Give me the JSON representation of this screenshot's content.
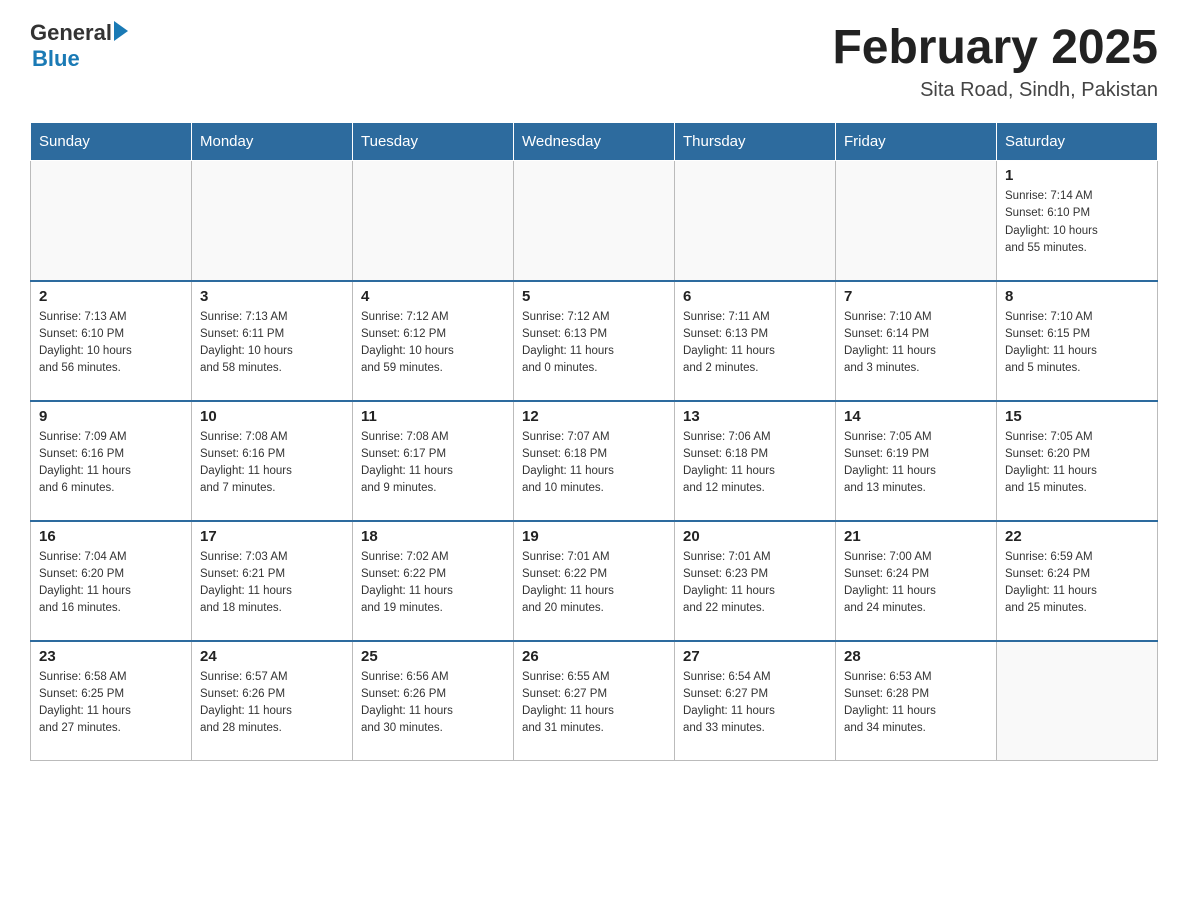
{
  "logo": {
    "text_general": "General",
    "text_blue": "Blue",
    "arrow": "▶"
  },
  "title": "February 2025",
  "subtitle": "Sita Road, Sindh, Pakistan",
  "days_of_week": [
    "Sunday",
    "Monday",
    "Tuesday",
    "Wednesday",
    "Thursday",
    "Friday",
    "Saturday"
  ],
  "weeks": [
    {
      "cells": [
        {
          "day": "",
          "info": ""
        },
        {
          "day": "",
          "info": ""
        },
        {
          "day": "",
          "info": ""
        },
        {
          "day": "",
          "info": ""
        },
        {
          "day": "",
          "info": ""
        },
        {
          "day": "",
          "info": ""
        },
        {
          "day": "1",
          "info": "Sunrise: 7:14 AM\nSunset: 6:10 PM\nDaylight: 10 hours\nand 55 minutes."
        }
      ]
    },
    {
      "cells": [
        {
          "day": "2",
          "info": "Sunrise: 7:13 AM\nSunset: 6:10 PM\nDaylight: 10 hours\nand 56 minutes."
        },
        {
          "day": "3",
          "info": "Sunrise: 7:13 AM\nSunset: 6:11 PM\nDaylight: 10 hours\nand 58 minutes."
        },
        {
          "day": "4",
          "info": "Sunrise: 7:12 AM\nSunset: 6:12 PM\nDaylight: 10 hours\nand 59 minutes."
        },
        {
          "day": "5",
          "info": "Sunrise: 7:12 AM\nSunset: 6:13 PM\nDaylight: 11 hours\nand 0 minutes."
        },
        {
          "day": "6",
          "info": "Sunrise: 7:11 AM\nSunset: 6:13 PM\nDaylight: 11 hours\nand 2 minutes."
        },
        {
          "day": "7",
          "info": "Sunrise: 7:10 AM\nSunset: 6:14 PM\nDaylight: 11 hours\nand 3 minutes."
        },
        {
          "day": "8",
          "info": "Sunrise: 7:10 AM\nSunset: 6:15 PM\nDaylight: 11 hours\nand 5 minutes."
        }
      ]
    },
    {
      "cells": [
        {
          "day": "9",
          "info": "Sunrise: 7:09 AM\nSunset: 6:16 PM\nDaylight: 11 hours\nand 6 minutes."
        },
        {
          "day": "10",
          "info": "Sunrise: 7:08 AM\nSunset: 6:16 PM\nDaylight: 11 hours\nand 7 minutes."
        },
        {
          "day": "11",
          "info": "Sunrise: 7:08 AM\nSunset: 6:17 PM\nDaylight: 11 hours\nand 9 minutes."
        },
        {
          "day": "12",
          "info": "Sunrise: 7:07 AM\nSunset: 6:18 PM\nDaylight: 11 hours\nand 10 minutes."
        },
        {
          "day": "13",
          "info": "Sunrise: 7:06 AM\nSunset: 6:18 PM\nDaylight: 11 hours\nand 12 minutes."
        },
        {
          "day": "14",
          "info": "Sunrise: 7:05 AM\nSunset: 6:19 PM\nDaylight: 11 hours\nand 13 minutes."
        },
        {
          "day": "15",
          "info": "Sunrise: 7:05 AM\nSunset: 6:20 PM\nDaylight: 11 hours\nand 15 minutes."
        }
      ]
    },
    {
      "cells": [
        {
          "day": "16",
          "info": "Sunrise: 7:04 AM\nSunset: 6:20 PM\nDaylight: 11 hours\nand 16 minutes."
        },
        {
          "day": "17",
          "info": "Sunrise: 7:03 AM\nSunset: 6:21 PM\nDaylight: 11 hours\nand 18 minutes."
        },
        {
          "day": "18",
          "info": "Sunrise: 7:02 AM\nSunset: 6:22 PM\nDaylight: 11 hours\nand 19 minutes."
        },
        {
          "day": "19",
          "info": "Sunrise: 7:01 AM\nSunset: 6:22 PM\nDaylight: 11 hours\nand 20 minutes."
        },
        {
          "day": "20",
          "info": "Sunrise: 7:01 AM\nSunset: 6:23 PM\nDaylight: 11 hours\nand 22 minutes."
        },
        {
          "day": "21",
          "info": "Sunrise: 7:00 AM\nSunset: 6:24 PM\nDaylight: 11 hours\nand 24 minutes."
        },
        {
          "day": "22",
          "info": "Sunrise: 6:59 AM\nSunset: 6:24 PM\nDaylight: 11 hours\nand 25 minutes."
        }
      ]
    },
    {
      "cells": [
        {
          "day": "23",
          "info": "Sunrise: 6:58 AM\nSunset: 6:25 PM\nDaylight: 11 hours\nand 27 minutes."
        },
        {
          "day": "24",
          "info": "Sunrise: 6:57 AM\nSunset: 6:26 PM\nDaylight: 11 hours\nand 28 minutes."
        },
        {
          "day": "25",
          "info": "Sunrise: 6:56 AM\nSunset: 6:26 PM\nDaylight: 11 hours\nand 30 minutes."
        },
        {
          "day": "26",
          "info": "Sunrise: 6:55 AM\nSunset: 6:27 PM\nDaylight: 11 hours\nand 31 minutes."
        },
        {
          "day": "27",
          "info": "Sunrise: 6:54 AM\nSunset: 6:27 PM\nDaylight: 11 hours\nand 33 minutes."
        },
        {
          "day": "28",
          "info": "Sunrise: 6:53 AM\nSunset: 6:28 PM\nDaylight: 11 hours\nand 34 minutes."
        },
        {
          "day": "",
          "info": ""
        }
      ]
    }
  ]
}
